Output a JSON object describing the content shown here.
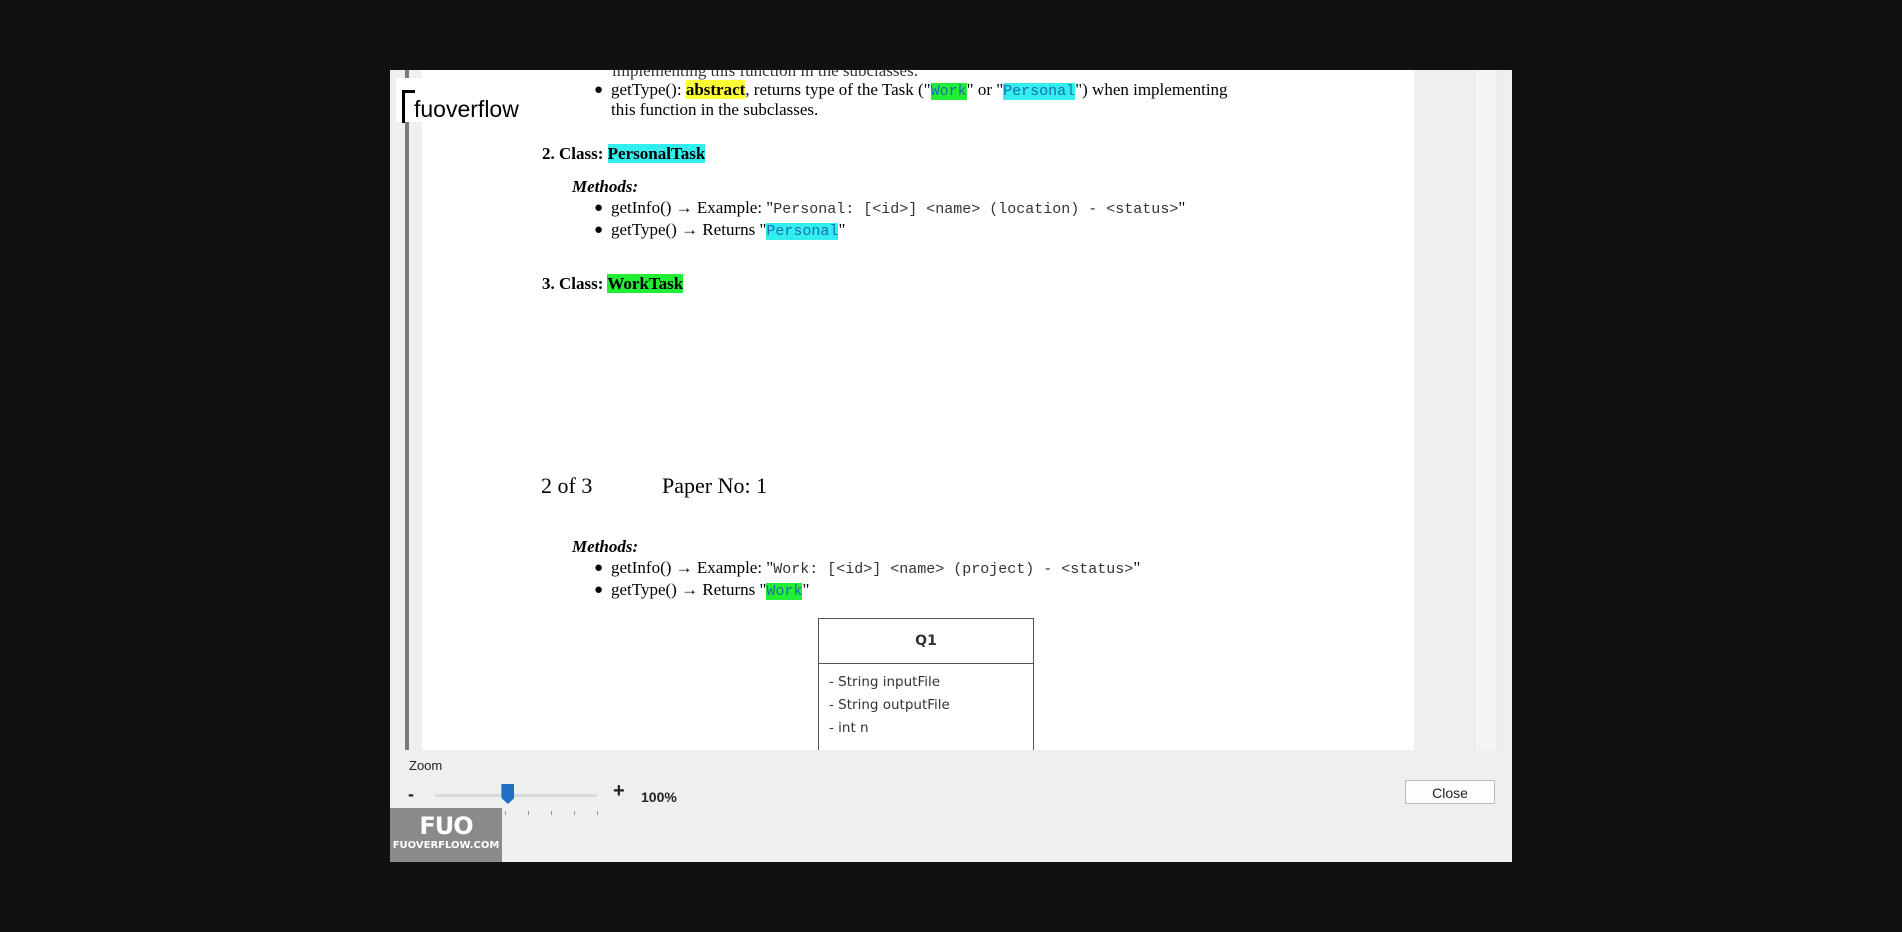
{
  "logo": {
    "text": "fuoverflow"
  },
  "doc": {
    "top_fragment": "implementing this function in the subclasses.",
    "gettype_line": {
      "prefix": "getType(): ",
      "abstract": "abstract",
      "middle": ", returns type of the Task (\"",
      "work": "Work",
      "or": "\" or \"",
      "personal": "Personal",
      "suffix": "\") when implementing",
      "cont": "this function in the subclasses."
    },
    "class2": {
      "label": "2. Class: ",
      "name": "PersonalTask"
    },
    "methods_label": "Methods:",
    "p_info": {
      "prefix": "getInfo() → Example: \"",
      "code": "Personal: [<id>] <name> (location) - <status>",
      "suffix": "\""
    },
    "p_type": {
      "prefix": "getType() → Returns \"",
      "code": "Personal",
      "suffix": "\""
    },
    "class3": {
      "label": "3. Class: ",
      "name": "WorkTask"
    },
    "page_no": "2 of 3",
    "paper_no": "Paper No: 1",
    "w_info": {
      "prefix": "getInfo() → Example: \"",
      "code": "Work: [<id>] <name> (project) - <status>",
      "suffix": "\""
    },
    "w_type": {
      "prefix": "getType() → Returns \"",
      "code": "Work",
      "suffix": "\""
    },
    "uml": {
      "title": "Q1",
      "attrs": [
        "- String inputFile",
        "- String outputFile",
        "- int n"
      ]
    }
  },
  "controls": {
    "zoom_label": "Zoom",
    "minus": "-",
    "plus": "+",
    "zoom_value": "100%",
    "zoom_level": 0.45,
    "close": "Close"
  },
  "watermark": {
    "logo": "FUO",
    "site": "FUOVERFLOW.COM"
  }
}
